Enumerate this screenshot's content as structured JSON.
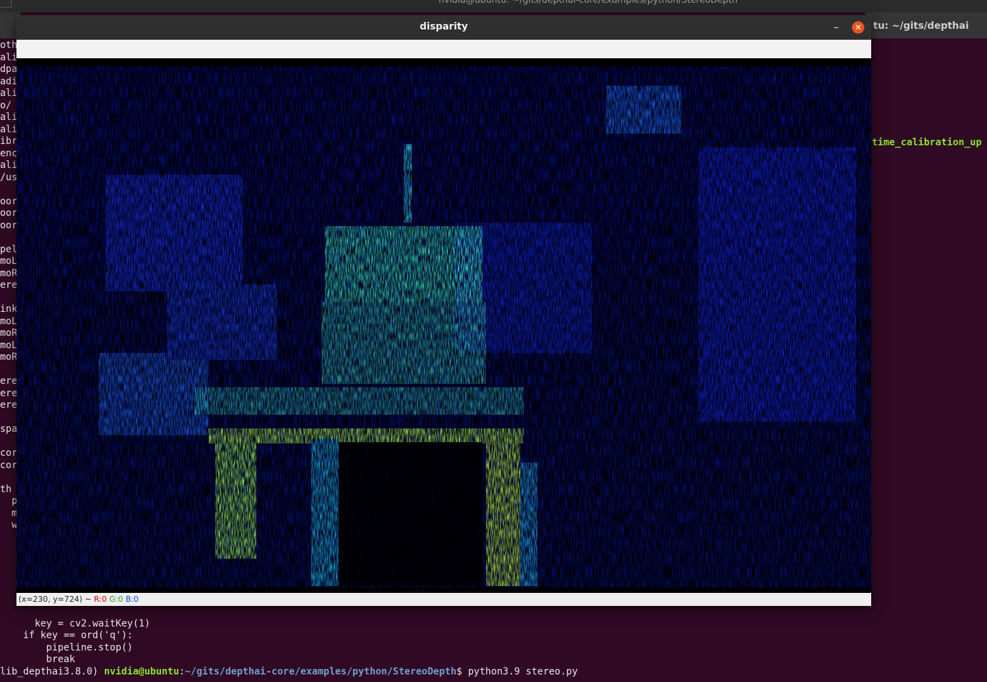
{
  "terminal": {
    "title_partial": "nvidia@ubuntu: ~/gits/depthai-core/examples/python/StereoDepth",
    "second_tab_title": "tu: ~/gits/depthai",
    "right_partial_text": "time_calibration_up",
    "left_line_fragments": [
      "otha",
      "alil",
      "dpa",
      "adi",
      "alil",
      "o/",
      "alil",
      "alil",
      "ibr",
      "enc",
      "alil",
      "/us",
      "",
      "oor",
      "oor",
      "oor",
      "",
      "pel",
      "moL",
      "moR",
      "ere",
      "",
      "ink",
      "moL",
      "moR",
      "moL",
      "moR",
      "",
      "ere",
      "ere",
      "ere",
      "",
      "spa",
      "",
      "cor",
      "cor",
      "",
      "th",
      "  p",
      "  m",
      "  w"
    ],
    "code_lines": [
      "    key = cv2.waitKey(1)",
      "    if key == ord('q'):",
      "        pipeline.stop()",
      "        break"
    ],
    "prompt": {
      "env": "lib_depthai3.8.0) ",
      "user": "nvidia@ubuntu",
      "sep": ":",
      "path": "~/gits/depthai-core/examples/python/StereoDepth",
      "dollar": "$ ",
      "command": "python3.9 stereo.py"
    }
  },
  "window": {
    "title": "disparity",
    "minimize_glyph": "–",
    "close_glyph": "✕"
  },
  "status": {
    "coords": "(x=230, y=724) ~ ",
    "r": "R:0",
    "g": "G:0",
    "b": "B:0"
  },
  "colors": {
    "terminal_bg": "#300a24",
    "disparity_far": "#0a10a0",
    "disparity_mid": "#1f5ff0",
    "disparity_near": "#3cf0c0",
    "disparity_nearest": "#c8ff40",
    "accent_close": "#e95420"
  }
}
